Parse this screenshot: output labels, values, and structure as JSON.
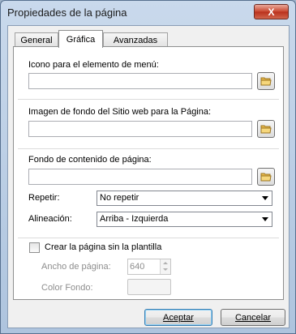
{
  "window": {
    "title": "Propiedades de la página",
    "close_glyph": "X"
  },
  "tabs": [
    {
      "label": "General",
      "active": false
    },
    {
      "label": "Gráfica",
      "active": true
    },
    {
      "label": "Avanzadas",
      "active": false
    }
  ],
  "menu_icon": {
    "label": "Icono para el elemento de menú:",
    "value": ""
  },
  "site_background": {
    "label": "Imagen de fondo del Sitio web para la Página:",
    "value": ""
  },
  "content_background": {
    "label": "Fondo de contenido de página:",
    "value": ""
  },
  "repeat": {
    "label": "Repetir:",
    "selected": "No repetir"
  },
  "alignment": {
    "label": "Alineación:",
    "selected": "Arriba - Izquierda"
  },
  "no_template": {
    "label": "Crear la página sin la plantilla",
    "checked": false
  },
  "page_width": {
    "label": "Ancho de página:",
    "value": "640"
  },
  "bg_color": {
    "label": "Color Fondo:"
  },
  "buttons": {
    "accept": "Aceptar",
    "cancel": "Cancelar"
  },
  "colors": {
    "title_bar": "#c9d9ec",
    "close_button": "#c9462f",
    "panel": "#ffffff",
    "folder_icon": "#e8b94a"
  }
}
